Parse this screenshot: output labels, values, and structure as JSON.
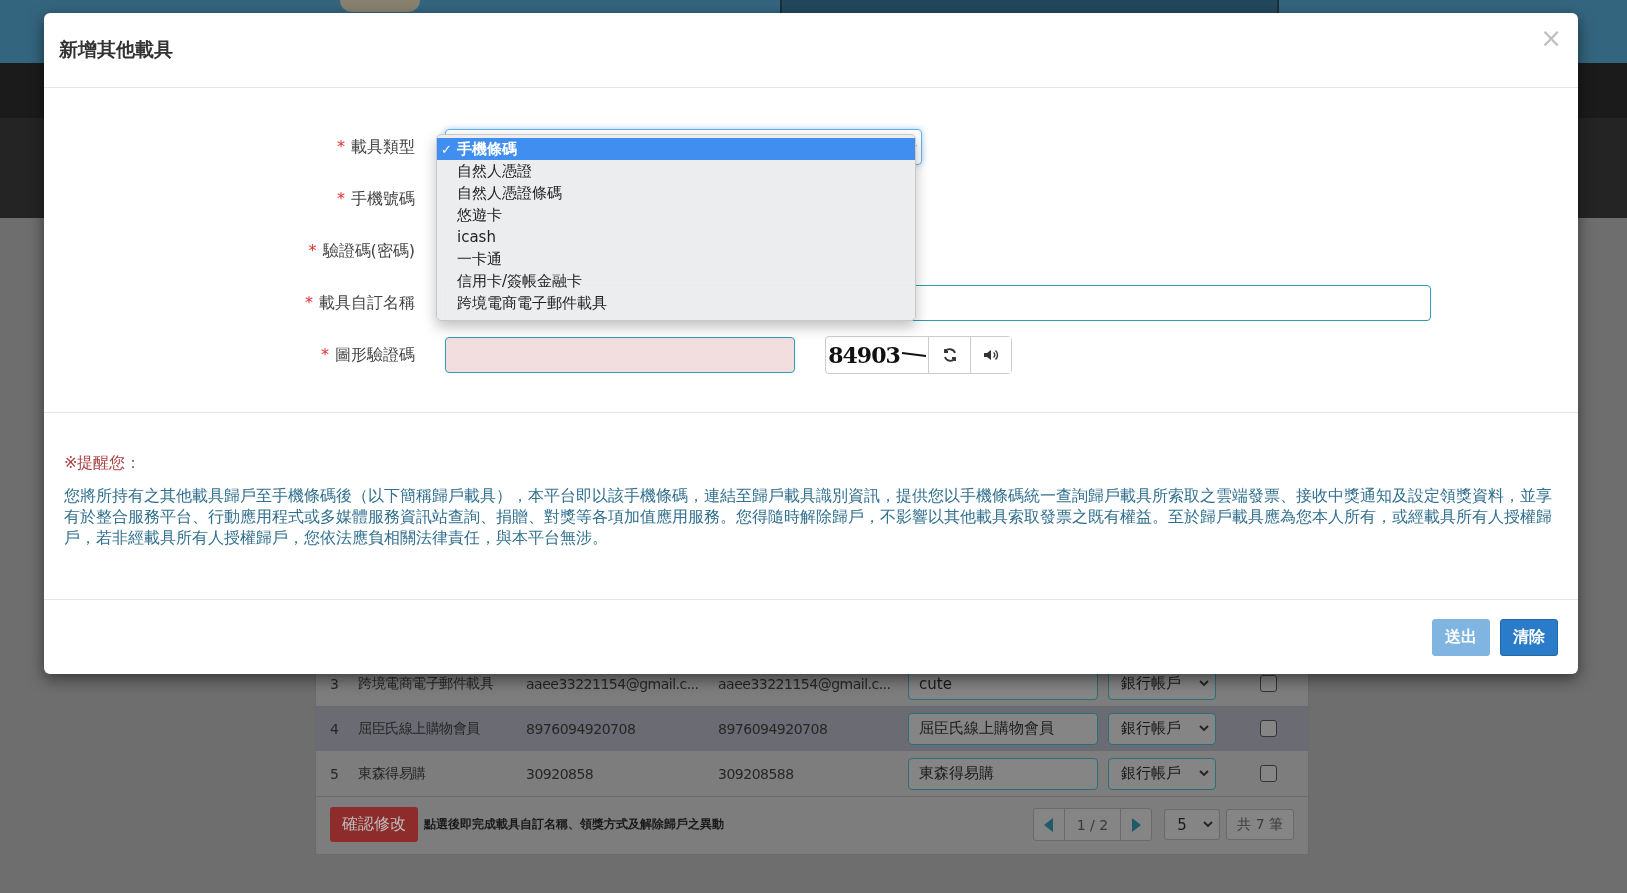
{
  "modal": {
    "title": "新增其他載具",
    "close": "×"
  },
  "form": {
    "fields": [
      {
        "marker": "*",
        "label": "載具類型",
        "kind": "select"
      },
      {
        "marker": "*",
        "label": "手機號碼",
        "kind": "covered"
      },
      {
        "marker": "*",
        "label": "驗證碼(密碼)",
        "kind": "covered"
      },
      {
        "marker": "*",
        "label": "載具自訂名稱",
        "kind": "text"
      },
      {
        "marker": "*",
        "label": "圖形驗證碼",
        "kind": "captcha"
      }
    ],
    "captcha_code": "84903",
    "dropdown": {
      "check_mark": "✓",
      "options": [
        {
          "label": "手機條碼",
          "selected": true
        },
        {
          "label": "自然人憑證",
          "selected": false
        },
        {
          "label": "自然人憑證條碼",
          "selected": false
        },
        {
          "label": "悠遊卡",
          "selected": false
        },
        {
          "label": "icash",
          "selected": false
        },
        {
          "label": "一卡通",
          "selected": false
        },
        {
          "label": "信用卡/簽帳金融卡",
          "selected": false
        },
        {
          "label": "跨境電商電子郵件載具",
          "selected": false
        }
      ]
    }
  },
  "notice": {
    "title": "※提醒您：",
    "body": "您將所持有之其他載具歸戶至手機條碼後（以下簡稱歸戶載具），本平台即以該手機條碼，連結至歸戶載具識別資訊，提供您以手機條碼統一查詢歸戶載具所索取之雲端發票、接收中獎通知及設定領獎資料，並享有於整合服務平台、行動應用程式或多媒體服務資訊站查詢、捐贈、對獎等各項加值應用服務。您得隨時解除歸戶，不影響以其他載具索取發票之既有權益。至於歸戶載具應為您本人所有，或經載具所有人授權歸戶，若非經載具所有人授權歸戶，您依法應負相關法律責任，與本平台無涉。"
  },
  "buttons": [
    {
      "label": "送出",
      "disabled": true
    },
    {
      "label": "清除",
      "disabled": false
    }
  ],
  "background_table": {
    "rows": [
      {
        "number": "3",
        "type": "跨境電商電子郵件載具",
        "id_1": "aaee33221154@gmail.c...",
        "id_2": "aaee33221154@gmail.c...",
        "name": "cute",
        "method": "銀行帳戶",
        "checked": false,
        "shaded": false
      },
      {
        "number": "4",
        "type": "屈臣氏線上購物會員",
        "id_1": "8976094920708",
        "id_2": "8976094920708",
        "name": "屈臣氏線上購物會員",
        "method": "銀行帳戶",
        "checked": false,
        "shaded": true
      },
      {
        "number": "5",
        "type": "東森得易購",
        "id_1": "30920858",
        "id_2": "309208588",
        "name": "東森得易購",
        "method": "銀行帳戶",
        "checked": false,
        "shaded": false
      }
    ],
    "confirm_button": "確認修改",
    "hint": "點選後即完成載具自訂名稱、領獎方式及解除歸戶之異動",
    "page": "1 / 2",
    "page_size": "5",
    "total": "共 7 筆"
  }
}
